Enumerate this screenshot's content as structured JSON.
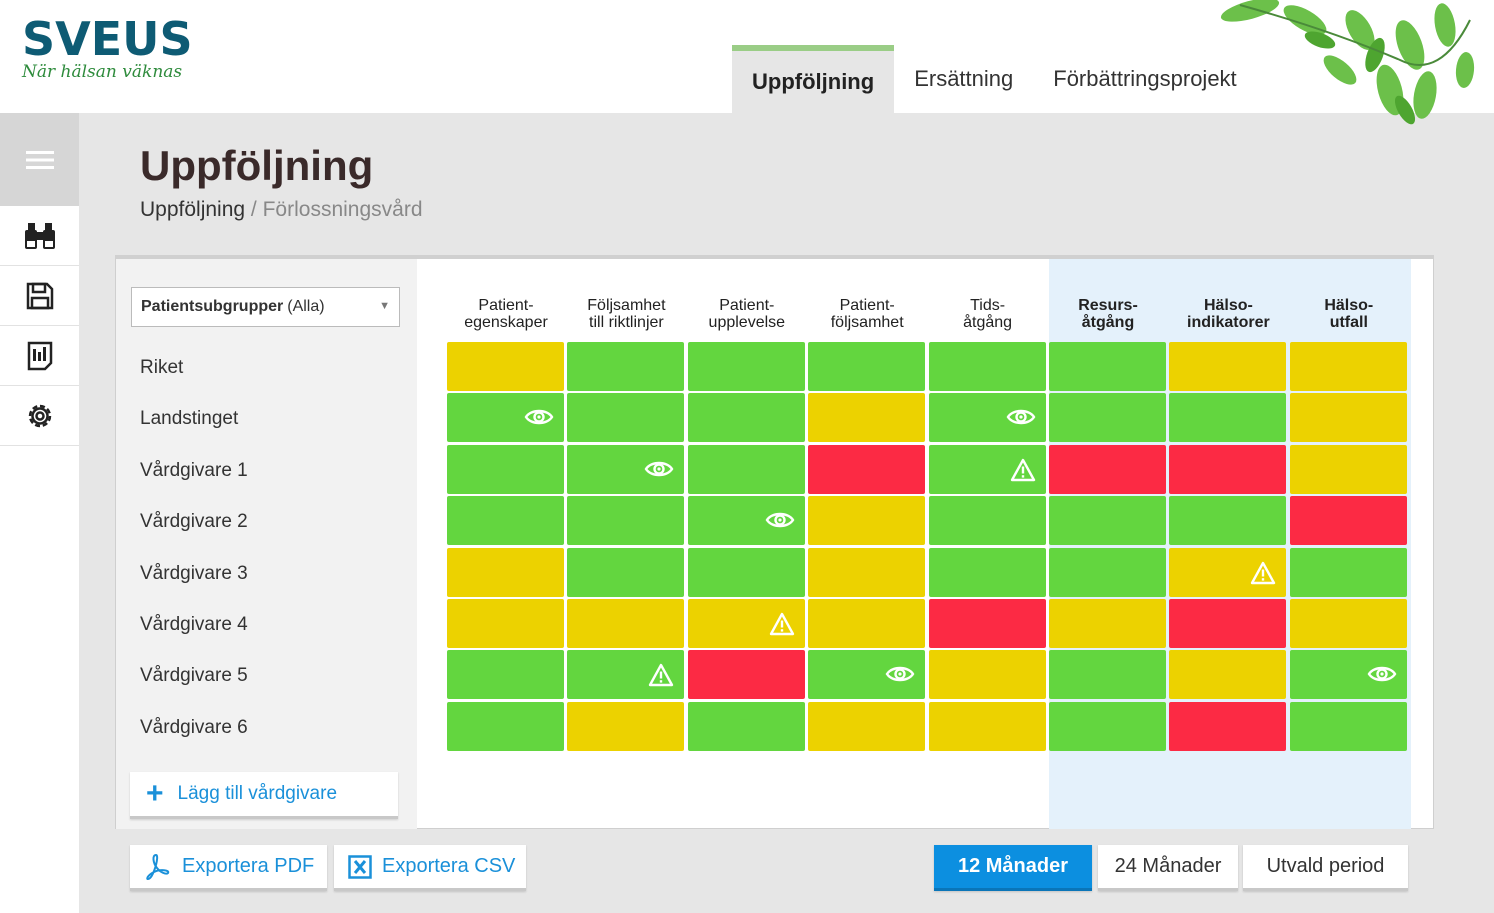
{
  "brand": {
    "name": "SVEUS",
    "tagline": "När hälsan väknas"
  },
  "nav": {
    "tabs": [
      {
        "label": "Uppföljning",
        "active": true
      },
      {
        "label": "Ersättning",
        "active": false
      },
      {
        "label": "Förbättringsprojekt",
        "active": false
      }
    ]
  },
  "sidebar": {
    "icons": [
      "menu-icon",
      "binoculars-icon",
      "save-icon",
      "report-icon",
      "settings-icon"
    ]
  },
  "page": {
    "title": "Uppföljning",
    "breadcrumb_root": "Uppföljning",
    "breadcrumb_sep": " / ",
    "breadcrumb_current": "Förlossningsvård"
  },
  "filter": {
    "label": "Patientsubgrupper",
    "value": "(Alla)"
  },
  "rows": [
    "Riket",
    "Landstinget",
    "Vårdgivare 1",
    "Vårdgivare 2",
    "Vårdgivare 3",
    "Vårdgivare 4",
    "Vårdgivare 5",
    "Vårdgivare 6"
  ],
  "columns": [
    {
      "line1": "Patient-",
      "line2": "egenskaper",
      "bold": false
    },
    {
      "line1": "Följsamhet",
      "line2": "till riktlinjer",
      "bold": false
    },
    {
      "line1": "Patient-",
      "line2": "upplevelse",
      "bold": false
    },
    {
      "line1": "Patient-",
      "line2": "följsamhet",
      "bold": false
    },
    {
      "line1": "Tids-",
      "line2": "åtgång",
      "bold": false
    },
    {
      "line1": "Resurs-",
      "line2": "åtgång",
      "bold": true
    },
    {
      "line1": "Hälso-",
      "line2": "indikatorer",
      "bold": true
    },
    {
      "line1": "Hälso-",
      "line2": "utfall",
      "bold": true
    }
  ],
  "grid": [
    [
      "y",
      "g",
      "g",
      "g",
      "g",
      "g",
      "y",
      "y"
    ],
    [
      "g",
      "g",
      "g",
      "y",
      "g",
      "g",
      "g",
      "y"
    ],
    [
      "g",
      "g",
      "g",
      "r",
      "g",
      "r",
      "r",
      "y"
    ],
    [
      "g",
      "g",
      "g",
      "y",
      "g",
      "g",
      "g",
      "r"
    ],
    [
      "y",
      "g",
      "g",
      "y",
      "g",
      "g",
      "y",
      "g"
    ],
    [
      "y",
      "y",
      "y",
      "y",
      "r",
      "y",
      "r",
      "y"
    ],
    [
      "g",
      "g",
      "r",
      "g",
      "y",
      "g",
      "y",
      "g"
    ],
    [
      "g",
      "y",
      "g",
      "y",
      "y",
      "g",
      "r",
      "g"
    ]
  ],
  "markers": [
    {
      "row": 1,
      "col": 0,
      "icon": "eye-icon"
    },
    {
      "row": 1,
      "col": 4,
      "icon": "eye-icon"
    },
    {
      "row": 2,
      "col": 1,
      "icon": "eye-icon"
    },
    {
      "row": 2,
      "col": 4,
      "icon": "warning-icon"
    },
    {
      "row": 3,
      "col": 2,
      "icon": "eye-icon"
    },
    {
      "row": 4,
      "col": 6,
      "icon": "warning-icon"
    },
    {
      "row": 5,
      "col": 2,
      "icon": "warning-icon"
    },
    {
      "row": 6,
      "col": 1,
      "icon": "warning-icon"
    },
    {
      "row": 6,
      "col": 3,
      "icon": "eye-icon"
    },
    {
      "row": 6,
      "col": 7,
      "icon": "eye-icon"
    }
  ],
  "colors": {
    "green": "#63d63f",
    "yellow": "#ecd200",
    "red": "#fc2a44",
    "accent": "#0c8fe0",
    "brand": "#0e5b74"
  },
  "actions": {
    "add_provider": "Lägg till vårdgivare",
    "export_pdf": "Exportera PDF",
    "export_csv": "Exportera CSV"
  },
  "period": {
    "options": [
      "12 Månader",
      "24 Månader",
      "Utvald period"
    ],
    "selected": "12 Månader"
  }
}
